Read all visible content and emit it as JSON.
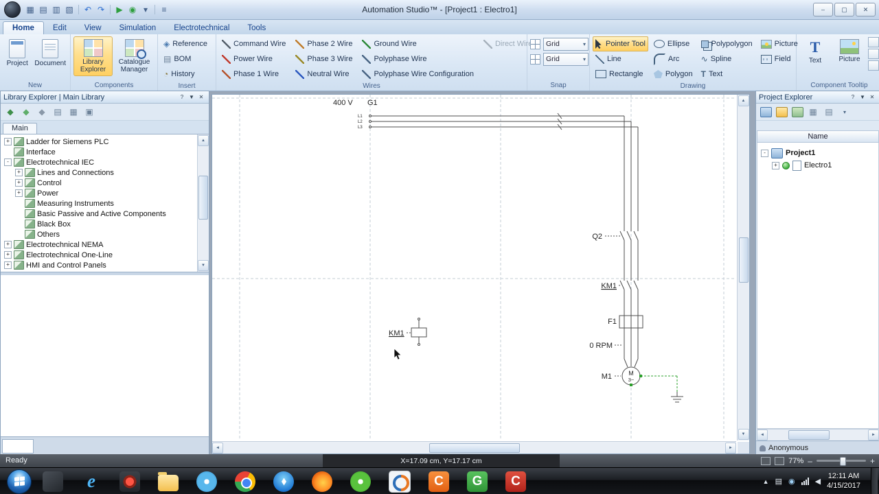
{
  "window": {
    "title": "Automation Studio™ - [Project1 : Electro1]"
  },
  "glyphs": {
    "help": "?",
    "min": "–",
    "max": "▢",
    "close": "✕",
    "pin": "▼",
    "up": "▲",
    "down": "▼",
    "left": "◄",
    "right": "►",
    "dd": "▾",
    "ie": "e",
    "c_orange": "C",
    "g_green": "G",
    "c_red": "C",
    "spline": "∿",
    "text_tool": "T",
    "reference": "◈",
    "bom": "▤",
    "history": "◔",
    "tray_up": "▲",
    "volume": "◀"
  },
  "tabs": {
    "items": [
      "Home",
      "Edit",
      "View",
      "Simulation",
      "Electrotechnical",
      "Tools"
    ]
  },
  "ribbon": {
    "new": {
      "label": "New",
      "project": "Project",
      "document": "Document"
    },
    "components": {
      "label": "Components",
      "library": "Library Explorer",
      "catalogue": "Catalogue Manager"
    },
    "insert": {
      "label": "Insert",
      "reference": "Reference",
      "bom": "BOM",
      "history": "History"
    },
    "wires": {
      "label": "Wires",
      "col1": [
        "Command Wire",
        "Power Wire",
        "Phase 1 Wire"
      ],
      "col2": [
        "Phase 2 Wire",
        "Phase 3 Wire",
        "Neutral Wire"
      ],
      "col3": [
        "Ground Wire",
        "Polyphase Wire",
        "Polyphase Wire Configuration"
      ],
      "direct": "Direct Wire"
    },
    "snap": {
      "label": "Snap",
      "grid1": "Grid",
      "grid2": "Grid"
    },
    "drawing": {
      "label": "Drawing",
      "col1": [
        "Pointer Tool",
        "Line",
        "Rectangle"
      ],
      "col2": [
        "Ellipse",
        "Arc",
        "Polygon"
      ],
      "col3": [
        "Polypolygon",
        "Spline",
        "Text"
      ],
      "col4": [
        "Picture",
        "Field"
      ]
    },
    "tooltip": {
      "label": "Component Tooltip",
      "text": "Text",
      "picture": "Picture"
    }
  },
  "library": {
    "title": "Library Explorer | Main Library",
    "tab": "Main",
    "tree": [
      {
        "label": "Ladder for Siemens PLC",
        "exp": "+"
      },
      {
        "label": "Interface",
        "exp": ""
      },
      {
        "label": "Electrotechnical IEC",
        "exp": "-"
      },
      {
        "label": "Lines and Connections",
        "exp": "+"
      },
      {
        "label": "Control",
        "exp": "+"
      },
      {
        "label": "Power",
        "exp": "+"
      },
      {
        "label": "Measuring Instruments",
        "exp": ""
      },
      {
        "label": "Basic Passive and Active Components",
        "exp": ""
      },
      {
        "label": "Black Box",
        "exp": ""
      },
      {
        "label": "Others",
        "exp": ""
      },
      {
        "label": "Electrotechnical NEMA",
        "exp": "+"
      },
      {
        "label": "Electrotechnical One-Line",
        "exp": "+"
      },
      {
        "label": "HMI and Control Panels",
        "exp": "+"
      }
    ]
  },
  "project": {
    "title": "Project Explorer",
    "name_header": "Name",
    "root": "Project1",
    "root_exp": "-",
    "doc": "Electro1",
    "doc_exp": "+",
    "user": "Anonymous"
  },
  "schematic": {
    "voltage": "400 V",
    "generator": "G1",
    "l1": "L1",
    "l2": "L2",
    "l3": "L3",
    "breaker": "Q2",
    "contactor": "KM1",
    "coil": "KM1",
    "overload": "F1",
    "speed": "0 RPM",
    "motor_label": "M1",
    "motor_letter": "M",
    "motor_type": "3~"
  },
  "statusbar": {
    "ready": "Ready",
    "coords": "X=17.09 cm, Y=17.17 cm",
    "zoom": "77%"
  },
  "taskbar": {
    "time": "12:11 AM",
    "date": "4/15/2017"
  }
}
